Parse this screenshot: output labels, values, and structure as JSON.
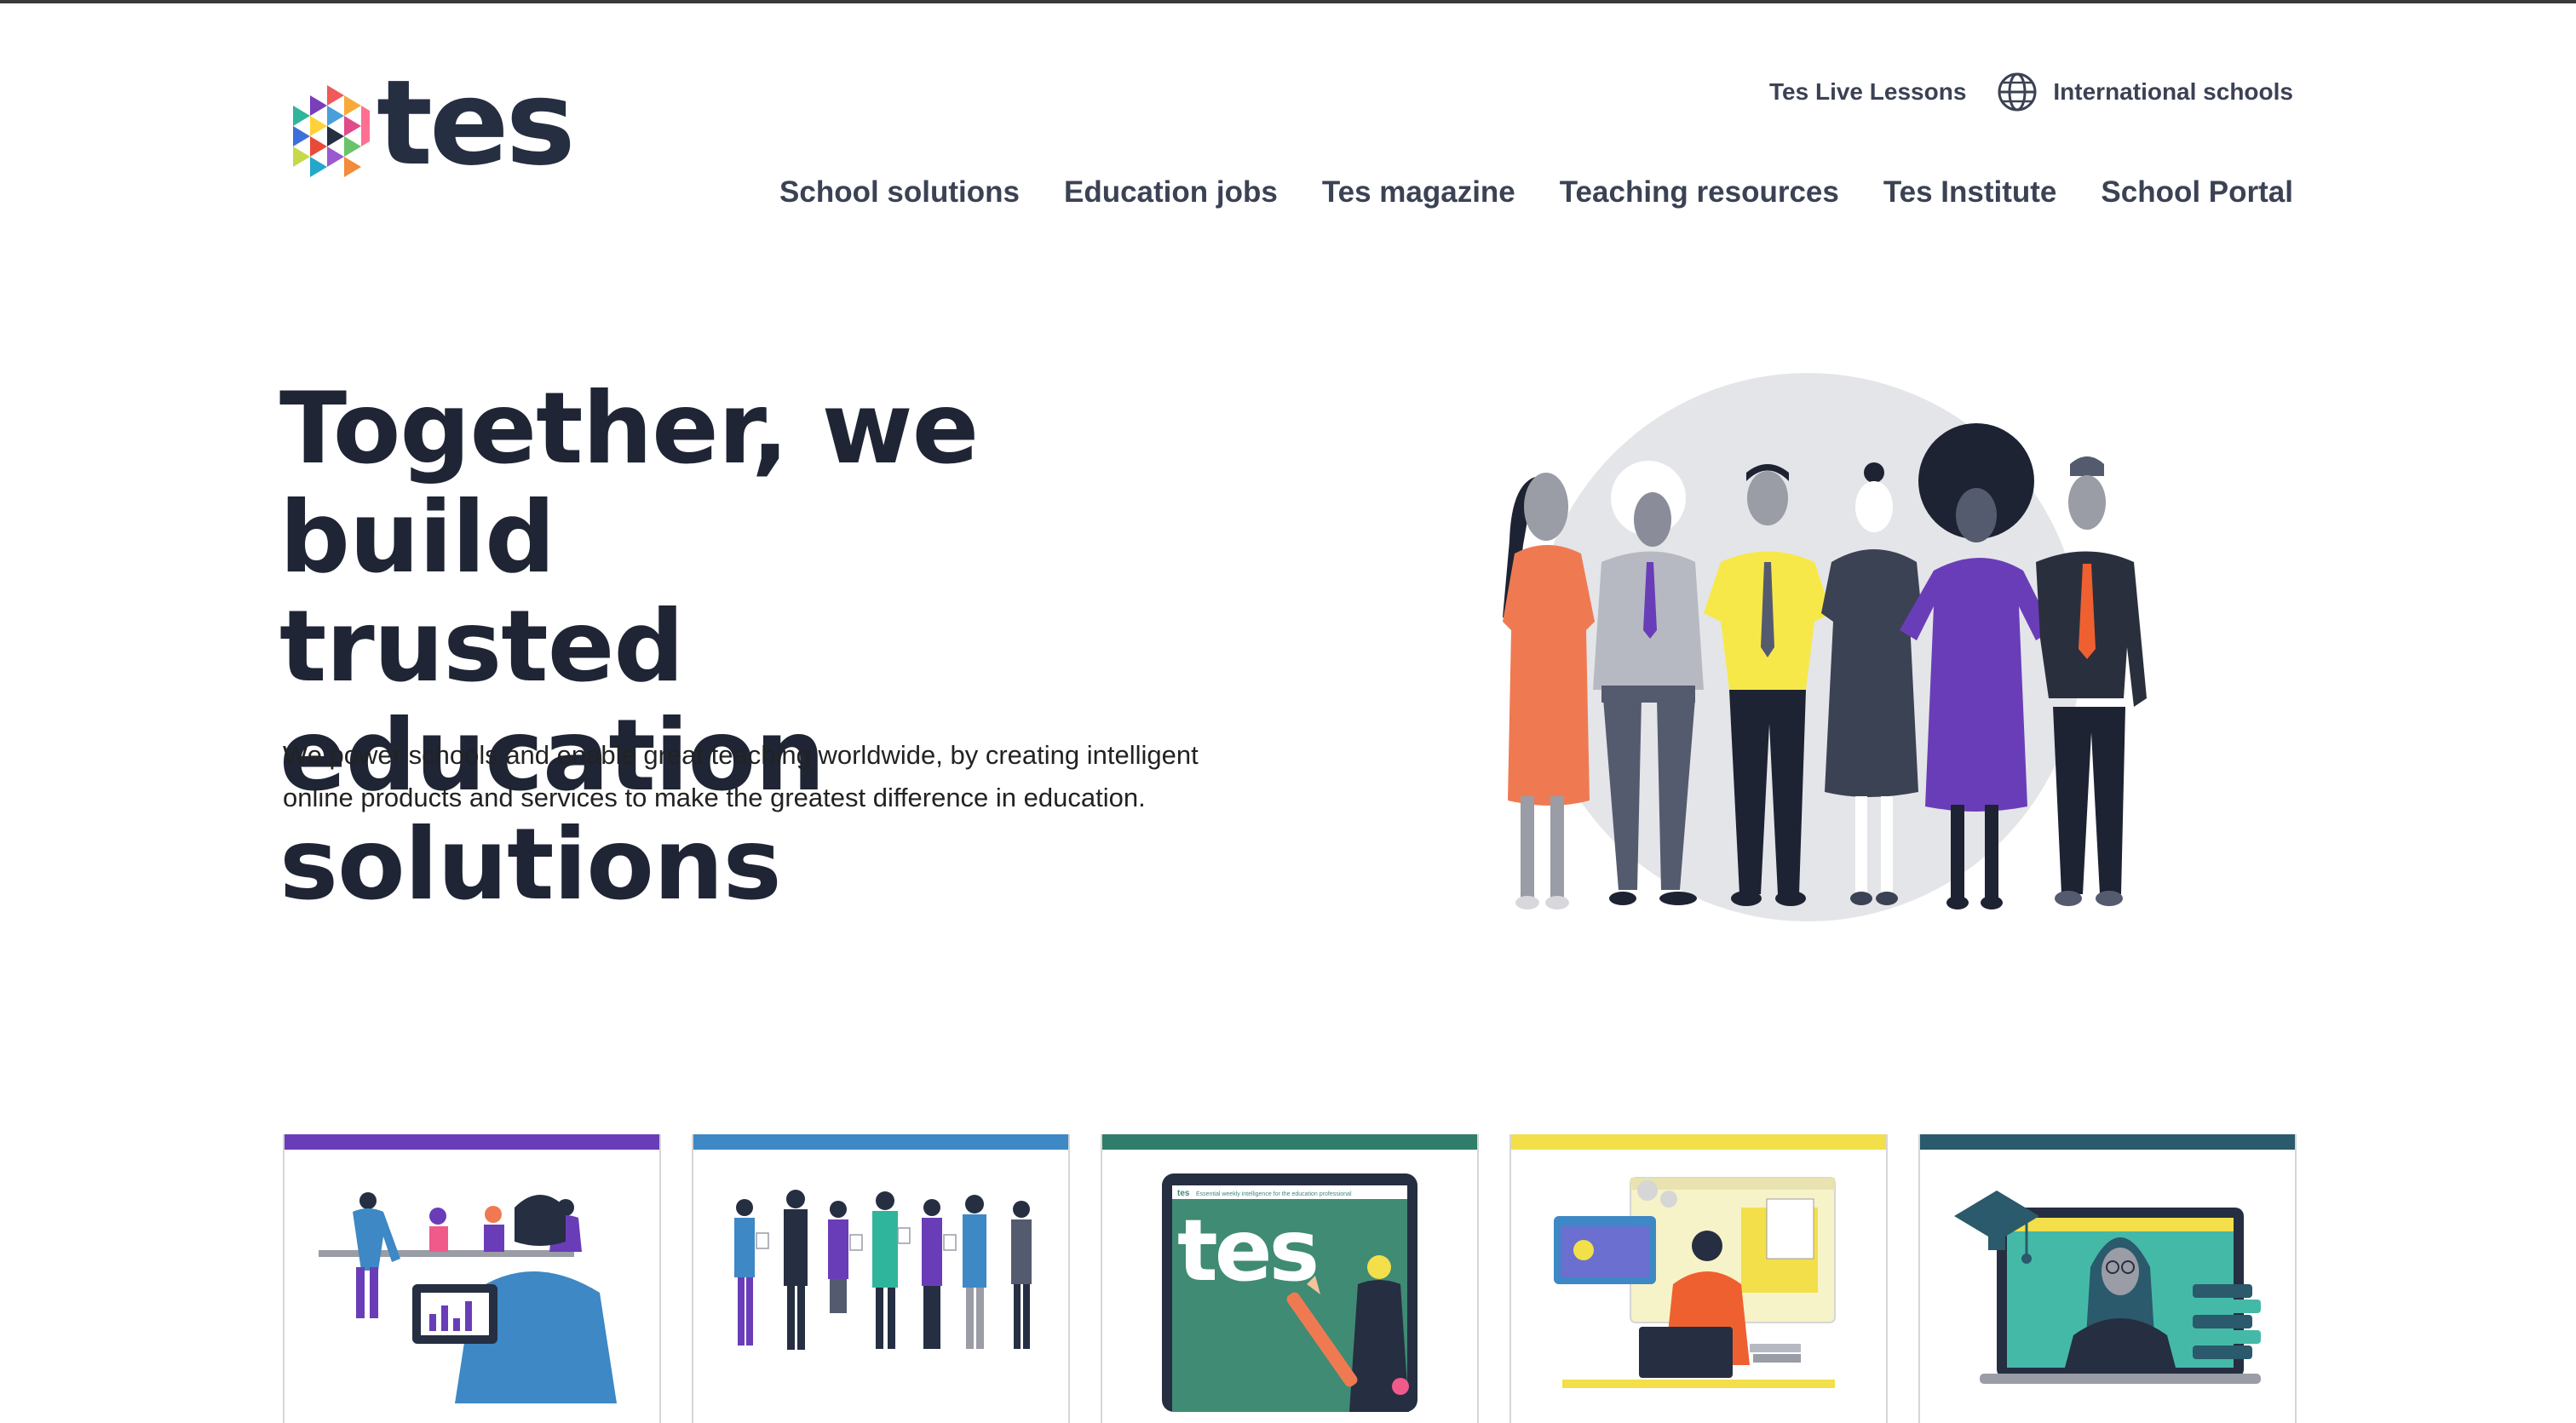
{
  "brand": {
    "name": "tes"
  },
  "utility_nav": {
    "live_lessons": "Tes Live Lessons",
    "international": "International schools"
  },
  "main_nav": {
    "items": [
      "School solutions",
      "Education jobs",
      "Tes magazine",
      "Teaching resources",
      "Tes Institute",
      "School Portal"
    ]
  },
  "hero": {
    "title_lines": [
      "Together, we build",
      "trusted education",
      "solutions"
    ],
    "description_lines": [
      "We power schools and enable great teaching worldwide, by creating intelligent",
      "online products and services to make the greatest difference in education."
    ]
  },
  "cards": [
    {
      "accent": "#6a3db8",
      "illustration": "teacher-with-tablet-illustration"
    },
    {
      "accent": "#3d88c5",
      "illustration": "staff-group-illustration"
    },
    {
      "accent": "#2f7d6a",
      "illustration": "tes-magazine-illustration",
      "magazine_logo": "tes",
      "magazine_tagline": "Essential weekly intelligence for the education professional"
    },
    {
      "accent": "#f2df4a",
      "illustration": "remote-worker-illustration"
    },
    {
      "accent": "#2a5a6b",
      "illustration": "online-learning-illustration"
    }
  ],
  "colors": {
    "text_dark": "#1f2535",
    "nav_text": "#3b4254"
  }
}
